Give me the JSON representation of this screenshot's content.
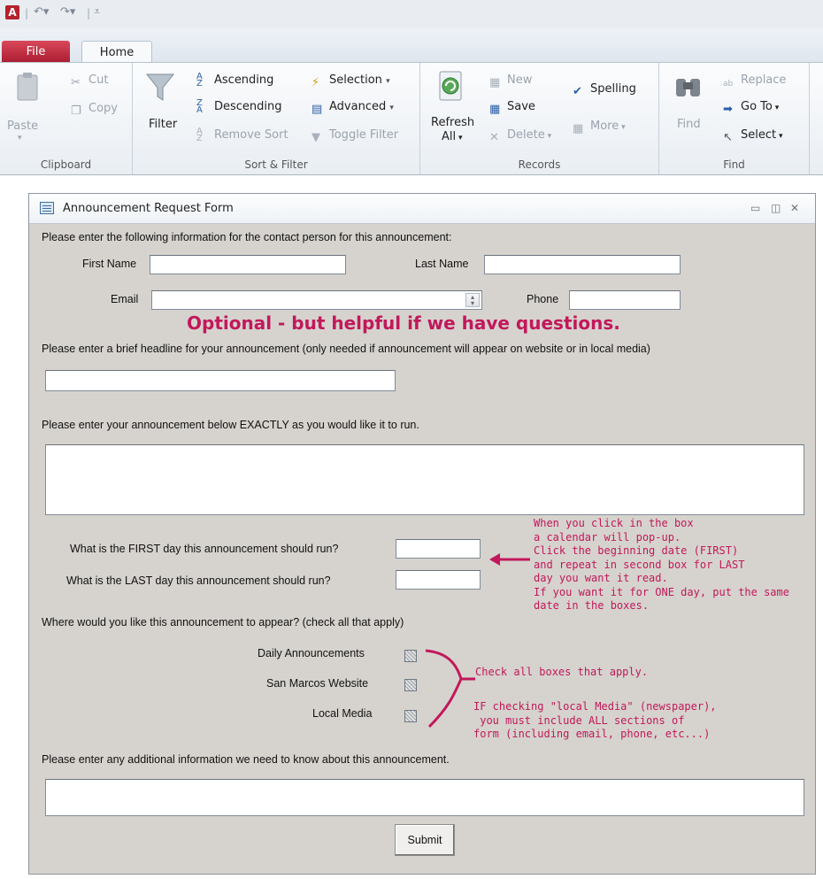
{
  "app": {
    "icon_letter": "A"
  },
  "tabs": {
    "file": "File",
    "home": "Home"
  },
  "ribbon": {
    "clipboard": {
      "label": "Clipboard",
      "paste": "Paste",
      "cut": "Cut",
      "copy": "Copy"
    },
    "sort_filter": {
      "label": "Sort & Filter",
      "filter": "Filter",
      "ascending": "Ascending",
      "descending": "Descending",
      "remove_sort": "Remove Sort",
      "selection": "Selection",
      "advanced": "Advanced",
      "toggle_filter": "Toggle Filter"
    },
    "records": {
      "label": "Records",
      "refresh": "Refresh",
      "refresh_sub": "All",
      "new": "New",
      "save": "Save",
      "delete": "Delete",
      "spelling": "Spelling",
      "more": "More"
    },
    "find": {
      "label": "Find",
      "find": "Find",
      "replace": "Replace",
      "goto": "Go To",
      "select": "Select"
    }
  },
  "form": {
    "title": "Announcement Request Form",
    "contact_intro": "Please enter the following information for the contact person for this announcement:",
    "first_name_label": "First Name",
    "last_name_label": "Last Name",
    "email_label": "Email",
    "phone_label": "Phone",
    "optional_note": "Optional - but helpful if we have questions.",
    "headline_label": "Please enter a brief headline for your announcement (only needed if announcement will appear on website or in local media)",
    "announcement_label": "Please enter your announcement below EXACTLY as you would like it to run.",
    "first_day_label": "What is the FIRST day this announcement should run?",
    "last_day_label": "What is the LAST day this announcement should run?",
    "calendar_note": "When you click in the box\na calendar will pop-up.\nClick the beginning date (FIRST)\nand repeat in second box for LAST\nday you want it read.\nIf you want it for ONE day, put the same\ndate in the boxes.",
    "where_label": "Where would you like this announcement to appear? (check all that apply)",
    "options": [
      {
        "label": "Daily Announcements"
      },
      {
        "label": "San Marcos Website"
      },
      {
        "label": "Local Media"
      }
    ],
    "check_note": "Check all boxes that apply.",
    "local_media_note": "IF checking \"local Media\" (newspaper),\n you must include ALL sections of\nform (including email, phone, etc...)",
    "additional_label": "Please enter any additional information we need to know about this announcement.",
    "submit": "Submit"
  }
}
